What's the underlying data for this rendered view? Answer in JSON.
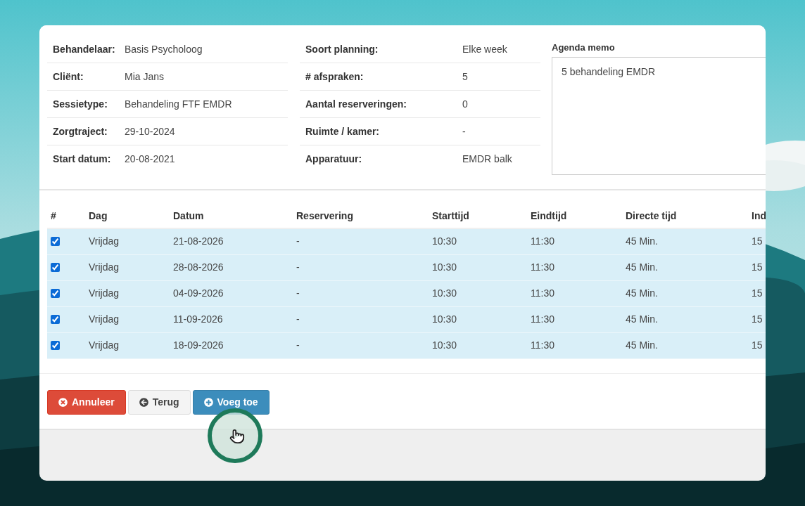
{
  "details_left": [
    {
      "label": "Behandelaar:",
      "value": "Basis Psycholoog"
    },
    {
      "label": "Cliënt:",
      "value": "Mia Jans"
    },
    {
      "label": "Sessietype:",
      "value": "Behandeling FTF EMDR"
    },
    {
      "label": "Zorgtraject:",
      "value": "29-10-2024"
    },
    {
      "label": "Start datum:",
      "value": "20-08-2021"
    }
  ],
  "details_right": [
    {
      "label": "Soort planning:",
      "value": "Elke week"
    },
    {
      "label": "# afspraken:",
      "value": "5"
    },
    {
      "label": "Aantal reserveringen:",
      "value": "0"
    },
    {
      "label": "Ruimte / kamer:",
      "value": "-"
    },
    {
      "label": "Apparatuur:",
      "value": "EMDR balk"
    }
  ],
  "memo": {
    "label": "Agenda memo",
    "value": "5 behandeling EMDR"
  },
  "table": {
    "checkbox_column_header": "#",
    "columns": [
      "Dag",
      "Datum",
      "Reservering",
      "Starttijd",
      "Eindtijd",
      "Directe tijd",
      "Ind"
    ],
    "rows": [
      {
        "checked": true,
        "cells": [
          "Vrijdag",
          "21-08-2026",
          "-",
          "10:30",
          "11:30",
          "45 Min.",
          "15"
        ]
      },
      {
        "checked": true,
        "cells": [
          "Vrijdag",
          "28-08-2026",
          "-",
          "10:30",
          "11:30",
          "45 Min.",
          "15"
        ]
      },
      {
        "checked": true,
        "cells": [
          "Vrijdag",
          "04-09-2026",
          "-",
          "10:30",
          "11:30",
          "45 Min.",
          "15"
        ]
      },
      {
        "checked": true,
        "cells": [
          "Vrijdag",
          "11-09-2026",
          "-",
          "10:30",
          "11:30",
          "45 Min.",
          "15"
        ]
      },
      {
        "checked": true,
        "cells": [
          "Vrijdag",
          "18-09-2026",
          "-",
          "10:30",
          "11:30",
          "45 Min.",
          "15"
        ]
      }
    ]
  },
  "buttons": [
    {
      "kind": "cancel",
      "label": "Annuleer"
    },
    {
      "kind": "back",
      "label": "Terug"
    },
    {
      "kind": "add",
      "label": "Voeg toe"
    }
  ]
}
